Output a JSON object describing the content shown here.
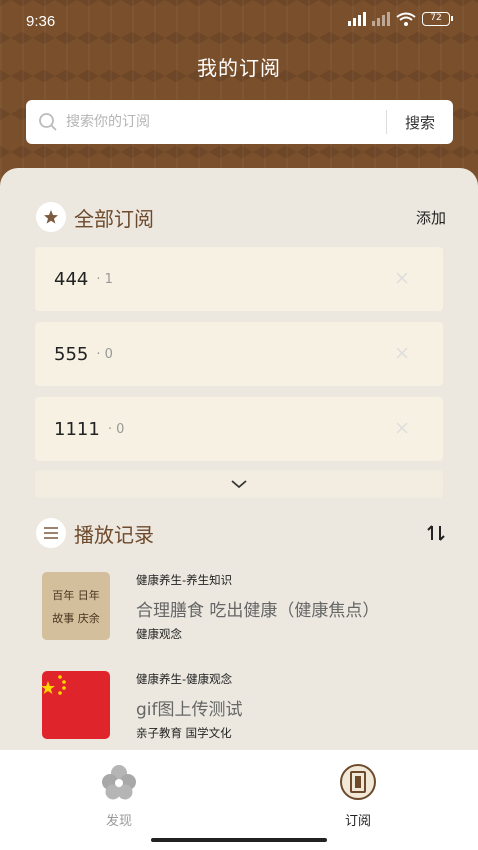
{
  "status_bar": {
    "time": "9:36",
    "battery": "72"
  },
  "page_title": "我的订阅",
  "search": {
    "placeholder": "搜索你的订阅",
    "button_label": "搜索"
  },
  "all_subscriptions": {
    "title": "全部订阅",
    "action_label": "添加",
    "items": [
      {
        "name": "444",
        "count": "1"
      },
      {
        "name": "555",
        "count": "0"
      },
      {
        "name": "1111",
        "count": "0"
      }
    ]
  },
  "play_history": {
    "title": "播放记录",
    "items": [
      {
        "category": "健康养生-养生知识",
        "title": "合理膳食 吃出健康（健康焦点）",
        "tags": "健康观念",
        "thumb_text": "百年故事 日年庆余"
      },
      {
        "category": "健康养生-健康观念",
        "title": "gif图上传测试",
        "tags": "亲子教育 国学文化"
      }
    ]
  },
  "tabbar": {
    "tabs": [
      {
        "label": "发现",
        "active": false
      },
      {
        "label": "订阅",
        "active": true
      }
    ]
  },
  "colors": {
    "header_brown": "#7a4f2c",
    "accent": "#6e4a2c",
    "card_bg": "#f6f1e3"
  }
}
